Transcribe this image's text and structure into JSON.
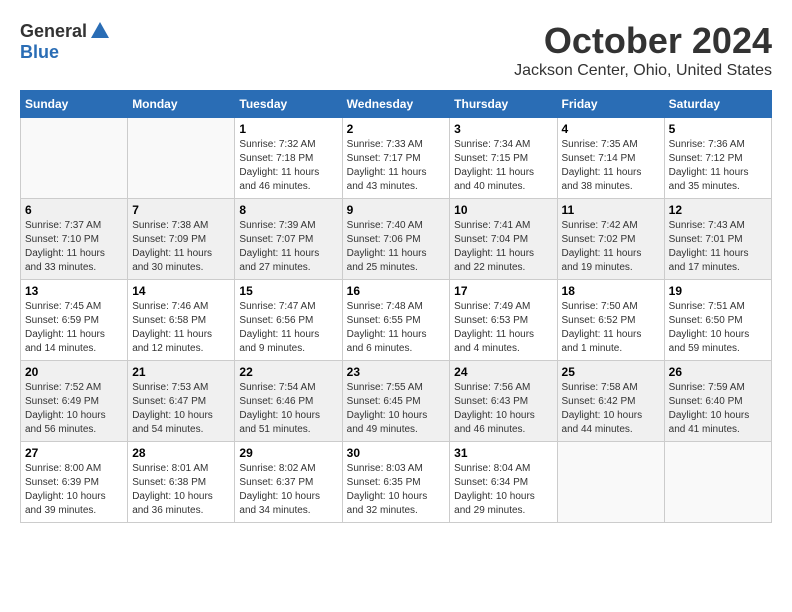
{
  "logo": {
    "general": "General",
    "blue": "Blue"
  },
  "title": "October 2024",
  "subtitle": "Jackson Center, Ohio, United States",
  "weekdays": [
    "Sunday",
    "Monday",
    "Tuesday",
    "Wednesday",
    "Thursday",
    "Friday",
    "Saturday"
  ],
  "weeks": [
    [
      {
        "day": "",
        "sunrise": "",
        "sunset": "",
        "daylight": ""
      },
      {
        "day": "",
        "sunrise": "",
        "sunset": "",
        "daylight": ""
      },
      {
        "day": "1",
        "sunrise": "Sunrise: 7:32 AM",
        "sunset": "Sunset: 7:18 PM",
        "daylight": "Daylight: 11 hours and 46 minutes."
      },
      {
        "day": "2",
        "sunrise": "Sunrise: 7:33 AM",
        "sunset": "Sunset: 7:17 PM",
        "daylight": "Daylight: 11 hours and 43 minutes."
      },
      {
        "day": "3",
        "sunrise": "Sunrise: 7:34 AM",
        "sunset": "Sunset: 7:15 PM",
        "daylight": "Daylight: 11 hours and 40 minutes."
      },
      {
        "day": "4",
        "sunrise": "Sunrise: 7:35 AM",
        "sunset": "Sunset: 7:14 PM",
        "daylight": "Daylight: 11 hours and 38 minutes."
      },
      {
        "day": "5",
        "sunrise": "Sunrise: 7:36 AM",
        "sunset": "Sunset: 7:12 PM",
        "daylight": "Daylight: 11 hours and 35 minutes."
      }
    ],
    [
      {
        "day": "6",
        "sunrise": "Sunrise: 7:37 AM",
        "sunset": "Sunset: 7:10 PM",
        "daylight": "Daylight: 11 hours and 33 minutes."
      },
      {
        "day": "7",
        "sunrise": "Sunrise: 7:38 AM",
        "sunset": "Sunset: 7:09 PM",
        "daylight": "Daylight: 11 hours and 30 minutes."
      },
      {
        "day": "8",
        "sunrise": "Sunrise: 7:39 AM",
        "sunset": "Sunset: 7:07 PM",
        "daylight": "Daylight: 11 hours and 27 minutes."
      },
      {
        "day": "9",
        "sunrise": "Sunrise: 7:40 AM",
        "sunset": "Sunset: 7:06 PM",
        "daylight": "Daylight: 11 hours and 25 minutes."
      },
      {
        "day": "10",
        "sunrise": "Sunrise: 7:41 AM",
        "sunset": "Sunset: 7:04 PM",
        "daylight": "Daylight: 11 hours and 22 minutes."
      },
      {
        "day": "11",
        "sunrise": "Sunrise: 7:42 AM",
        "sunset": "Sunset: 7:02 PM",
        "daylight": "Daylight: 11 hours and 19 minutes."
      },
      {
        "day": "12",
        "sunrise": "Sunrise: 7:43 AM",
        "sunset": "Sunset: 7:01 PM",
        "daylight": "Daylight: 11 hours and 17 minutes."
      }
    ],
    [
      {
        "day": "13",
        "sunrise": "Sunrise: 7:45 AM",
        "sunset": "Sunset: 6:59 PM",
        "daylight": "Daylight: 11 hours and 14 minutes."
      },
      {
        "day": "14",
        "sunrise": "Sunrise: 7:46 AM",
        "sunset": "Sunset: 6:58 PM",
        "daylight": "Daylight: 11 hours and 12 minutes."
      },
      {
        "day": "15",
        "sunrise": "Sunrise: 7:47 AM",
        "sunset": "Sunset: 6:56 PM",
        "daylight": "Daylight: 11 hours and 9 minutes."
      },
      {
        "day": "16",
        "sunrise": "Sunrise: 7:48 AM",
        "sunset": "Sunset: 6:55 PM",
        "daylight": "Daylight: 11 hours and 6 minutes."
      },
      {
        "day": "17",
        "sunrise": "Sunrise: 7:49 AM",
        "sunset": "Sunset: 6:53 PM",
        "daylight": "Daylight: 11 hours and 4 minutes."
      },
      {
        "day": "18",
        "sunrise": "Sunrise: 7:50 AM",
        "sunset": "Sunset: 6:52 PM",
        "daylight": "Daylight: 11 hours and 1 minute."
      },
      {
        "day": "19",
        "sunrise": "Sunrise: 7:51 AM",
        "sunset": "Sunset: 6:50 PM",
        "daylight": "Daylight: 10 hours and 59 minutes."
      }
    ],
    [
      {
        "day": "20",
        "sunrise": "Sunrise: 7:52 AM",
        "sunset": "Sunset: 6:49 PM",
        "daylight": "Daylight: 10 hours and 56 minutes."
      },
      {
        "day": "21",
        "sunrise": "Sunrise: 7:53 AM",
        "sunset": "Sunset: 6:47 PM",
        "daylight": "Daylight: 10 hours and 54 minutes."
      },
      {
        "day": "22",
        "sunrise": "Sunrise: 7:54 AM",
        "sunset": "Sunset: 6:46 PM",
        "daylight": "Daylight: 10 hours and 51 minutes."
      },
      {
        "day": "23",
        "sunrise": "Sunrise: 7:55 AM",
        "sunset": "Sunset: 6:45 PM",
        "daylight": "Daylight: 10 hours and 49 minutes."
      },
      {
        "day": "24",
        "sunrise": "Sunrise: 7:56 AM",
        "sunset": "Sunset: 6:43 PM",
        "daylight": "Daylight: 10 hours and 46 minutes."
      },
      {
        "day": "25",
        "sunrise": "Sunrise: 7:58 AM",
        "sunset": "Sunset: 6:42 PM",
        "daylight": "Daylight: 10 hours and 44 minutes."
      },
      {
        "day": "26",
        "sunrise": "Sunrise: 7:59 AM",
        "sunset": "Sunset: 6:40 PM",
        "daylight": "Daylight: 10 hours and 41 minutes."
      }
    ],
    [
      {
        "day": "27",
        "sunrise": "Sunrise: 8:00 AM",
        "sunset": "Sunset: 6:39 PM",
        "daylight": "Daylight: 10 hours and 39 minutes."
      },
      {
        "day": "28",
        "sunrise": "Sunrise: 8:01 AM",
        "sunset": "Sunset: 6:38 PM",
        "daylight": "Daylight: 10 hours and 36 minutes."
      },
      {
        "day": "29",
        "sunrise": "Sunrise: 8:02 AM",
        "sunset": "Sunset: 6:37 PM",
        "daylight": "Daylight: 10 hours and 34 minutes."
      },
      {
        "day": "30",
        "sunrise": "Sunrise: 8:03 AM",
        "sunset": "Sunset: 6:35 PM",
        "daylight": "Daylight: 10 hours and 32 minutes."
      },
      {
        "day": "31",
        "sunrise": "Sunrise: 8:04 AM",
        "sunset": "Sunset: 6:34 PM",
        "daylight": "Daylight: 10 hours and 29 minutes."
      },
      {
        "day": "",
        "sunrise": "",
        "sunset": "",
        "daylight": ""
      },
      {
        "day": "",
        "sunrise": "",
        "sunset": "",
        "daylight": ""
      }
    ]
  ]
}
